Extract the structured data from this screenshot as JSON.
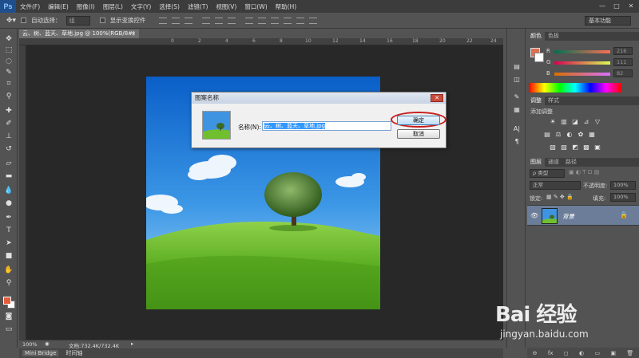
{
  "app": {
    "logo": "Ps",
    "menu": [
      "文件(F)",
      "编辑(E)",
      "图像(I)",
      "图层(L)",
      "文字(Y)",
      "选择(S)",
      "滤镜(T)",
      "视图(V)",
      "窗口(W)",
      "帮助(H)"
    ],
    "window_controls": [
      "—",
      "□",
      "✕"
    ]
  },
  "options_bar": {
    "auto_select_label": "自动选择：",
    "auto_select_value": "组",
    "show_transform_label": "显示变换控件",
    "workspace": "基本功能"
  },
  "document": {
    "tab_title": "云、树、蓝天、草地.jpg @ 100%(RGB/8#)",
    "tab_close": "×",
    "ruler_ticks": [
      "0",
      "2",
      "4",
      "6",
      "8",
      "10",
      "12",
      "14",
      "16",
      "18",
      "20",
      "22",
      "24",
      "26"
    ],
    "zoom": "100%",
    "doc_info": "文档:732.4K/732.4K"
  },
  "bottom_panel": {
    "tabs": [
      "Mini Bridge",
      "时间轴"
    ]
  },
  "color_panel": {
    "tabs": [
      "颜色",
      "色板"
    ],
    "channels": [
      {
        "label": "R",
        "value": "216"
      },
      {
        "label": "G",
        "value": "111"
      },
      {
        "label": "B",
        "value": "82"
      }
    ],
    "foreground": "#e06f52",
    "background": "#ffffff"
  },
  "adjustments_panel": {
    "tabs": [
      "调整",
      "样式"
    ],
    "hint": "添加调整",
    "icons_row1": [
      "☀",
      "▥",
      "◪",
      "⊿",
      "▽"
    ],
    "icons_row2": [
      "▤",
      "⚖",
      "◐",
      "✿",
      "▦"
    ],
    "icons_row3": [
      "▧",
      "▨",
      "◩",
      "▩",
      "▣"
    ]
  },
  "layers_panel": {
    "tabs": [
      "图层",
      "通道",
      "路径"
    ],
    "kind_filter": "ρ 类型",
    "blend_mode": "正常",
    "opacity_label": "不透明度:",
    "opacity_value": "100%",
    "lock_label": "锁定:",
    "fill_label": "填充:",
    "fill_value": "100%",
    "layer_name": "背景",
    "footer_icons": [
      "⊖",
      "fx",
      "◻",
      "◐",
      "▭",
      "▣",
      "🗑"
    ]
  },
  "dialog": {
    "title": "图案名称",
    "close": "✕",
    "name_label": "名称(N):",
    "name_value": "云、树、蓝天、草地.jpg",
    "ok_label": "确定",
    "cancel_label": "取消"
  },
  "watermark": {
    "brand": "Bai 经验",
    "url": "jingyan.baidu.com"
  }
}
